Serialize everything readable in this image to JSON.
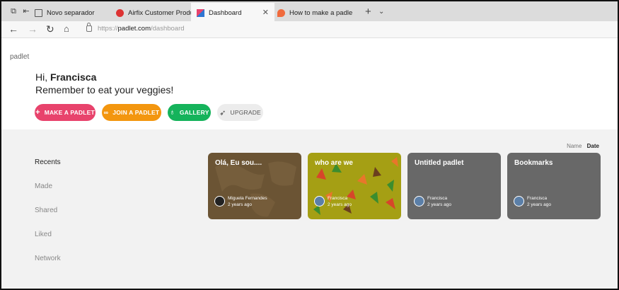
{
  "browser": {
    "tabs": [
      {
        "label": "Novo separador"
      },
      {
        "label": "Airfix Customer Product Im"
      },
      {
        "label": "Dashboard",
        "close": "✕"
      },
      {
        "label": "How to make a padlet"
      }
    ],
    "url_prefix": "https://",
    "url_host": "padlet.com",
    "url_path": "/dashboard"
  },
  "page": {
    "brand": "padlet",
    "greeting_prefix": "Hi, ",
    "user_name": "Francisca",
    "subtitle": "Remember to eat your veggies!"
  },
  "actions": {
    "make": "MAKE A PADLET",
    "join": "JOIN A PADLET",
    "gallery": "GALLERY",
    "upgrade": "UPGRADE"
  },
  "sort": {
    "name": "Name",
    "date": "Date"
  },
  "sidebar": {
    "items": [
      {
        "label": "Recents"
      },
      {
        "label": "Made"
      },
      {
        "label": "Shared"
      },
      {
        "label": "Liked"
      },
      {
        "label": "Network"
      }
    ]
  },
  "padlets": [
    {
      "title": "Olá, Eu sou....",
      "author": "Miguela Fernandes",
      "time": "2 years ago",
      "color": "#6b5434"
    },
    {
      "title": "who are we",
      "author": "Francisca",
      "time": "2 years ago",
      "color": "#a59f14"
    },
    {
      "title": "Untitled padlet",
      "author": "Francisca",
      "time": "2 years ago",
      "color": "#686868"
    },
    {
      "title": "Bookmarks",
      "author": "Francisca",
      "time": "2 years ago",
      "color": "#686868"
    }
  ],
  "colors": {
    "make": "#e8436c",
    "join": "#f3960f",
    "gallery": "#15b35b"
  },
  "icons": [
    "tab-actions-icon",
    "back-icon",
    "forward-icon",
    "refresh-icon",
    "home-icon",
    "lock-icon",
    "add-icon",
    "link-icon",
    "lightbulb-icon",
    "rocket-icon"
  ]
}
